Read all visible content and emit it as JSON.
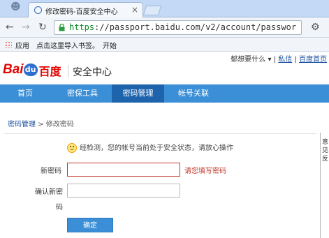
{
  "browser": {
    "tab_title": "修改密码-百度安全中心",
    "tab_close": "×",
    "url_scheme": "https",
    "url_rest": "://passport.baidu.com/v2/account/passwor",
    "back_glyph": "←",
    "forward_glyph": "→",
    "reload_glyph": "↻",
    "menu_glyph": "⚙",
    "bookmarks": {
      "apps": "应用",
      "import_hint": "点击这里导入书签。",
      "start": "开始"
    }
  },
  "header": {
    "logo_latin": "Bai",
    "logo_paw": "du",
    "logo_cn": "百度",
    "site_name": "安全中心",
    "top_links": {
      "username": "郁想要什么",
      "dropdown": "▾",
      "sep": "|",
      "message": "私信",
      "home": "百度首页"
    }
  },
  "menu": {
    "items": [
      {
        "label": "首页"
      },
      {
        "label": "密保工具"
      },
      {
        "label": "密码管理"
      },
      {
        "label": "帐号关联"
      }
    ],
    "active": "密码管理"
  },
  "page": {
    "breadcrumb_parent": "密码管理",
    "breadcrumb_sep": ">",
    "breadcrumb_current": "修改密码",
    "notice": "经检测，您的帐号当前处于安全状态，请放心操作",
    "new_password_label": "新密码",
    "confirm_label_line1": "确认新密",
    "confirm_label_line2": "码",
    "error_message": "请您填写密码",
    "submit_label": "确定",
    "side_text": "意 见 反"
  },
  "colors": {
    "accent": "#3b8fd6",
    "menu_active": "#1d64ad",
    "brand_red": "#e10601",
    "error": "#c0392b"
  }
}
